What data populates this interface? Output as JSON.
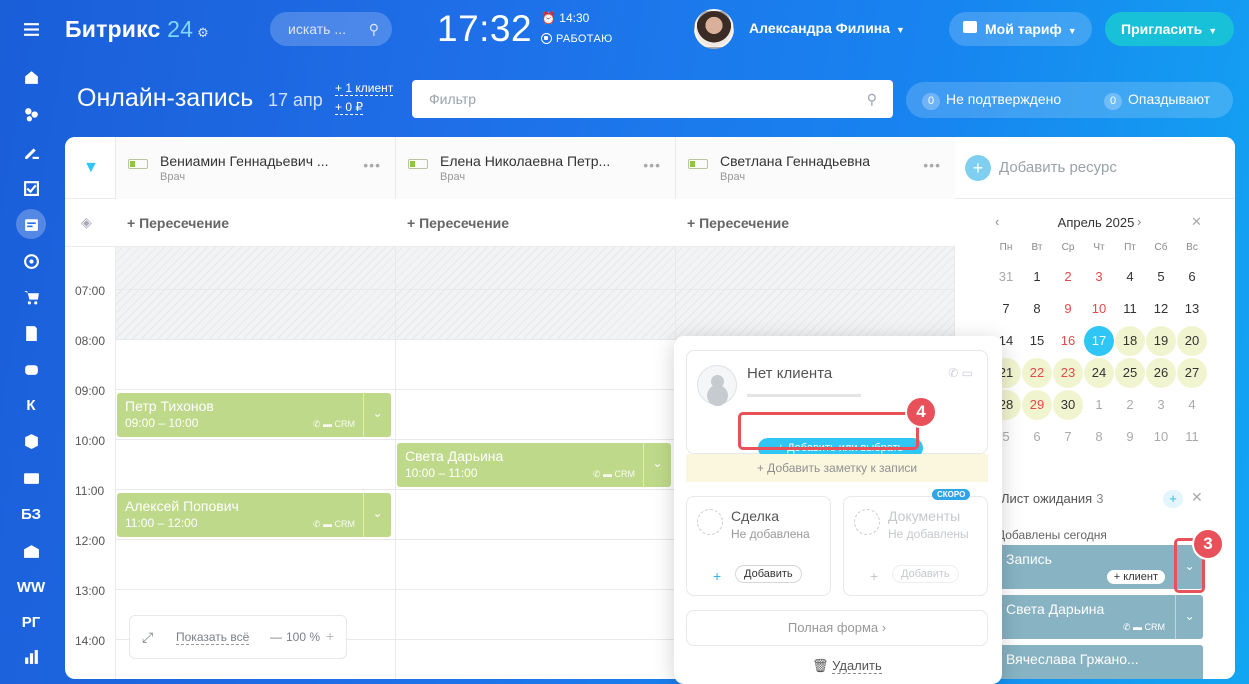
{
  "header": {
    "logo": "Битрикс",
    "logo_num": "24",
    "search_placeholder": "искать ...",
    "clock": "17:32",
    "alarm": "14:30",
    "status": "РАБОТАЮ",
    "user_name": "Александра Филина",
    "tariff": "Мой тариф",
    "invite": "Пригласить"
  },
  "rail": [
    "menu-icon",
    "home-icon",
    "activity-icon",
    "tasks-icon",
    "checklist-icon",
    "booking-icon",
    "target-icon",
    "cart-icon",
    "docs-icon",
    "robot-icon",
    "К",
    "box-icon",
    "contacts-icon",
    "БЗ",
    "store-icon",
    "WW",
    "РГ",
    "analytics-icon"
  ],
  "page": {
    "title": "Онлайн-запись",
    "date": "17 апр",
    "stat_clients": "+ 1 клиент",
    "stat_money": "+ 0 ₽",
    "filter_placeholder": "Фильтр",
    "unconfirmed_count": "0",
    "unconfirmed": "Не подтверждено",
    "late_count": "0",
    "late": "Опаздывают"
  },
  "resources": [
    {
      "name": "Вениамин Геннадьевич ...",
      "role": "Врач"
    },
    {
      "name": "Елена Николаевна Петр...",
      "role": "Врач"
    },
    {
      "name": "Светлана Геннадьевна",
      "role": "Врач"
    }
  ],
  "add_resource": "Добавить ресурс",
  "crossing_label": "+ Пересечение",
  "times": [
    "07:00",
    "08:00",
    "09:00",
    "10:00",
    "11:00",
    "12:00",
    "13:00",
    "14:00"
  ],
  "appointments": [
    {
      "name": "Петр Тихонов",
      "time": "09:00 – 10:00"
    },
    {
      "name": "Света Дарьина",
      "time": "10:00 – 11:00"
    },
    {
      "name": "Алексей Попович",
      "time": "11:00 – 12:00"
    }
  ],
  "zoom": {
    "show_all": "Показать всё",
    "percent": "100 %"
  },
  "calendar": {
    "month": "Апрель 2025",
    "weekdays": [
      "Пн",
      "Вт",
      "Ср",
      "Чт",
      "Пт",
      "Сб",
      "Вс"
    ],
    "days": [
      "31",
      "1",
      "2",
      "3",
      "4",
      "5",
      "6",
      "7",
      "8",
      "9",
      "10",
      "11",
      "12",
      "13",
      "14",
      "15",
      "16",
      "17",
      "18",
      "19",
      "20",
      "21",
      "22",
      "23",
      "24",
      "25",
      "26",
      "27",
      "28",
      "29",
      "30",
      "1",
      "2",
      "3",
      "4",
      "5",
      "6",
      "7",
      "8",
      "9",
      "10",
      "11"
    ],
    "selected": "17"
  },
  "waitlist": {
    "title": "Лист ожидания",
    "count": "3",
    "added_today": "Добавлены сегодня",
    "items": [
      {
        "name": "Запись",
        "client_btn": "+ клиент"
      },
      {
        "name": "Света Дарьина"
      },
      {
        "name": "Вячеслава Гржано..."
      }
    ]
  },
  "popup": {
    "no_client": "Нет клиента",
    "add_or_select": "+ Добавить или выбрать",
    "add_note": "+ Добавить заметку к записи",
    "deal_title": "Сделка",
    "deal_status": "Не добавлена",
    "add_label": "Добавить",
    "docs_title": "Документы",
    "docs_status": "Не добавлены",
    "soon": "СКОРО",
    "full_form": "Полная форма",
    "delete": "Удалить"
  },
  "callouts": [
    "3",
    "4"
  ],
  "colors": {
    "accent": "#2fc6f6",
    "appointment": "#bfd98a",
    "waitlist": "#87b3c3",
    "callout": "#e8515a"
  }
}
